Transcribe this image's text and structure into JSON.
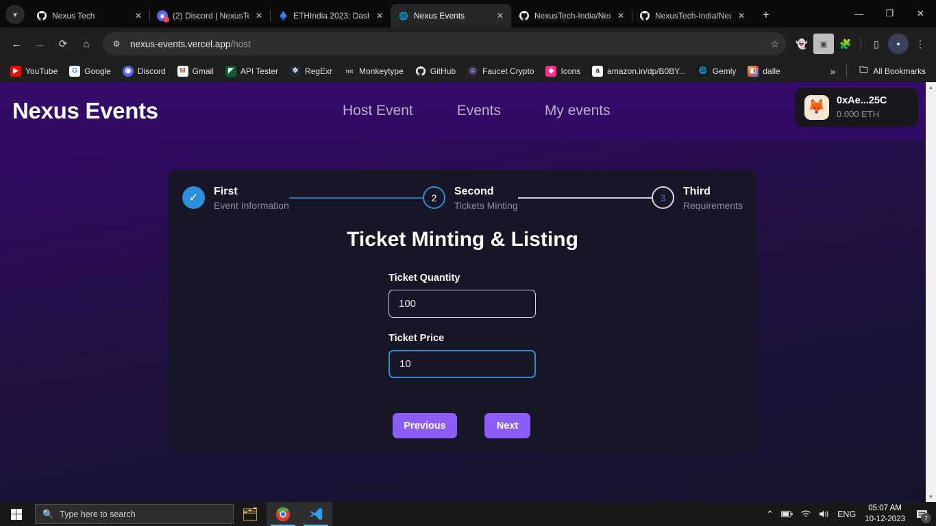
{
  "browser": {
    "tabs": [
      {
        "title": "Nexus Tech",
        "icon": "github-icon",
        "active": false
      },
      {
        "title": "(2) Discord | NexusTe",
        "icon": "discord-icon",
        "active": false
      },
      {
        "title": "ETHIndia 2023: Dashb",
        "icon": "ethindia-icon",
        "active": false
      },
      {
        "title": "Nexus Events",
        "icon": "globe-icon",
        "active": true
      },
      {
        "title": "NexusTech-India/Nex",
        "icon": "github-icon",
        "active": false
      },
      {
        "title": "NexusTech-India/Nex",
        "icon": "github-icon",
        "active": false
      }
    ],
    "new_tab_label": "+",
    "window_controls": {
      "minimize": "—",
      "maximize": "❐",
      "close": "✕"
    },
    "nav": {
      "back": "←",
      "forward": "→",
      "reload": "⟳",
      "home": "⌂"
    },
    "omnibox": {
      "site_settings_icon": "tune-icon",
      "url_host": "nexus-events.vercel.app",
      "url_path": "/host",
      "bookmark_star": "☆"
    },
    "toolbar_icons": [
      "ghost-extension-icon",
      "screenshot-extension-icon",
      "extensions-puzzle-icon",
      "side-panel-icon",
      "profile-avatar-icon",
      "chrome-menu-icon"
    ],
    "bookmarks": [
      {
        "label": "YouTube",
        "icon": "youtube-icon",
        "color": "#ff0000"
      },
      {
        "label": "Google",
        "icon": "google-icon",
        "color": "#ffffff"
      },
      {
        "label": "Discord",
        "icon": "discord-icon",
        "color": "#5865f2"
      },
      {
        "label": "Gmail",
        "icon": "gmail-icon",
        "color": "#ffffff"
      },
      {
        "label": "API Tester",
        "icon": "api-tester-icon",
        "color": "#0b5e3a"
      },
      {
        "label": "RegExr",
        "icon": "regexr-icon",
        "color": "#1d2b36"
      },
      {
        "label": "Monkeytype",
        "icon": "monkeytype-icon",
        "color": "#2b2b2b"
      },
      {
        "label": "GitHub",
        "icon": "github-icon",
        "color": "#151515"
      },
      {
        "label": "Faucet Crypto",
        "icon": "faucet-crypto-icon",
        "color": "#2a2a3a"
      },
      {
        "label": "Icons",
        "icon": "icons-icon",
        "color": "#ff2e88"
      },
      {
        "label": "amazon.in/dp/B0BY...",
        "icon": "amazon-icon",
        "color": "#ffffff"
      },
      {
        "label": "Gemly",
        "icon": "gemly-icon",
        "color": "#1a1a1a"
      },
      {
        "label": "dalle",
        "icon": "dalle-icon",
        "color": "#f0a030"
      }
    ],
    "bookmarks_overflow": "»",
    "all_bookmarks_label": "All Bookmarks",
    "all_bookmarks_icon": "folder-icon"
  },
  "site": {
    "brand": "Nexus Events",
    "nav_links": [
      "Host Event",
      "Events",
      "My events"
    ],
    "wallet": {
      "icon": "metamask-fox-icon",
      "address": "0xAe...25C",
      "balance": "0.000 ETH"
    },
    "stepper": [
      {
        "num": "✓",
        "state": "done",
        "title": "First",
        "sub": "Event Information"
      },
      {
        "num": "2",
        "state": "active",
        "title": "Second",
        "sub": "Tickets Minting"
      },
      {
        "num": "3",
        "state": "todo",
        "title": "Third",
        "sub": "Requirements"
      }
    ],
    "form": {
      "title": "Ticket Minting & Listing",
      "fields": [
        {
          "label": "Ticket Quantity",
          "value": "100",
          "placeholder": "",
          "focused": false
        },
        {
          "label": "Ticket Price",
          "value": "10",
          "placeholder": "",
          "focused": true
        }
      ],
      "previous_label": "Previous",
      "next_label": "Next"
    },
    "colors": {
      "accent_purple": "#8b5cf6",
      "step_blue": "#2b8fd9",
      "card_bg": "#161627",
      "nav_bg": "#350c6b"
    }
  },
  "taskbar": {
    "start_icon": "windows-start-icon",
    "search_placeholder": "Type here to search",
    "search_icon": "search-icon",
    "apps": [
      {
        "name": "file-explorer-icon",
        "glyph": "🗂",
        "open": false
      },
      {
        "name": "chrome-icon",
        "glyph": "◉",
        "open": true
      },
      {
        "name": "vscode-icon",
        "glyph": "⧗",
        "open": true
      }
    ],
    "tray": {
      "chevron": "⌃",
      "battery_icon": "battery-icon",
      "wifi_icon": "wifi-icon",
      "volume_icon": "volume-icon",
      "language": "ENG",
      "time": "05:07 AM",
      "date": "10-12-2023",
      "notification_icon": "notifications-icon",
      "notification_count": "7"
    }
  }
}
